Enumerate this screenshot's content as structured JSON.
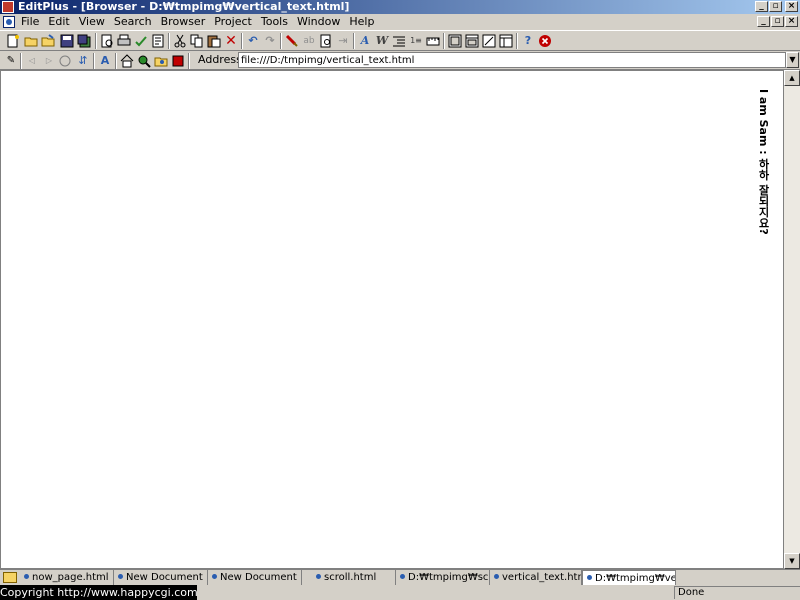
{
  "window": {
    "title": "EditPlus - [Browser - D:₩tmpimg₩vertical_text.html]",
    "controls": [
      "_",
      "▫",
      "×"
    ]
  },
  "menu": [
    "File",
    "Edit",
    "View",
    "Search",
    "Browser",
    "Project",
    "Tools",
    "Window",
    "Help"
  ],
  "toolbar": {
    "icons": [
      "new-file-icon",
      "open-icon",
      "open-remote-icon",
      "save-icon",
      "save-all-icon",
      "print-preview-icon",
      "print-icon",
      "spell-check-icon",
      "browser-icon",
      "cut-icon",
      "copy-icon",
      "paste-icon",
      "delete-icon",
      "undo-icon",
      "redo-icon",
      "find-icon",
      "replace-icon",
      "find-in-files-icon",
      "go-to-icon",
      "font-icon",
      "word-wrap-icon",
      "indent-icon",
      "line-number-icon",
      "ruler-icon",
      "full-screen-icon",
      "toggle-output-icon",
      "clip-text-icon",
      "directory-icon",
      "help-icon",
      "stop-icon"
    ]
  },
  "address": {
    "label": "Address",
    "value": "file:///D:/tmpimg/vertical_text.html"
  },
  "content": {
    "vertical_text": "I am Sam : 하하 잘되지요?"
  },
  "tabs": [
    {
      "label": "now_page.html",
      "active": false
    },
    {
      "label": "New Document",
      "active": false
    },
    {
      "label": "New Document",
      "active": false
    },
    {
      "label": "scroll.html",
      "active": false
    },
    {
      "label": "D:₩tmpimg₩scroll",
      "active": false
    },
    {
      "label": "vertical_text.html",
      "active": false
    },
    {
      "label": "D:₩tmpimg₩vertic",
      "active": true
    }
  ],
  "status": {
    "copyright": "Copyright   http://www.happycgi.com",
    "state": "Done"
  }
}
